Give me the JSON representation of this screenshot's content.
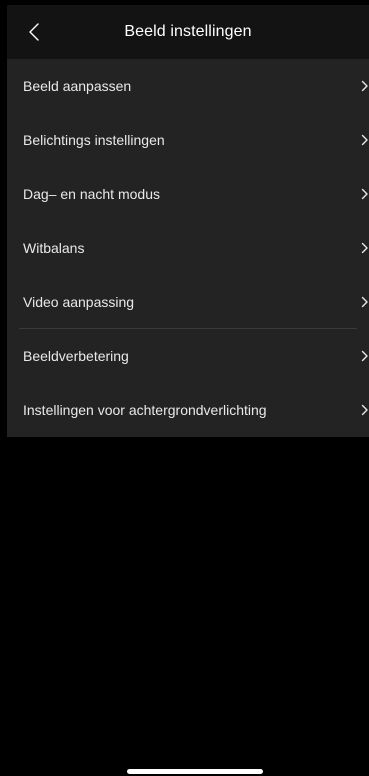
{
  "header": {
    "title": "Beeld instellingen",
    "back_icon": "chevron-left-icon"
  },
  "menu": {
    "items": [
      {
        "label": "Beeld aanpassen"
      },
      {
        "label": "Belichtings instellingen"
      },
      {
        "label": "Dag– en nacht modus"
      },
      {
        "label": "Witbalans"
      },
      {
        "label": "Video aanpassing"
      },
      {
        "label": "Beeldverbetering"
      },
      {
        "label": "Instellingen voor achtergrondverlichting"
      }
    ],
    "item_icon": "chevron-right-icon"
  },
  "colors": {
    "background": "#000000",
    "header_bg": "#131313",
    "menu_bg": "#232323",
    "text": "#e9e9e9",
    "divider": "#3a3a3a"
  }
}
